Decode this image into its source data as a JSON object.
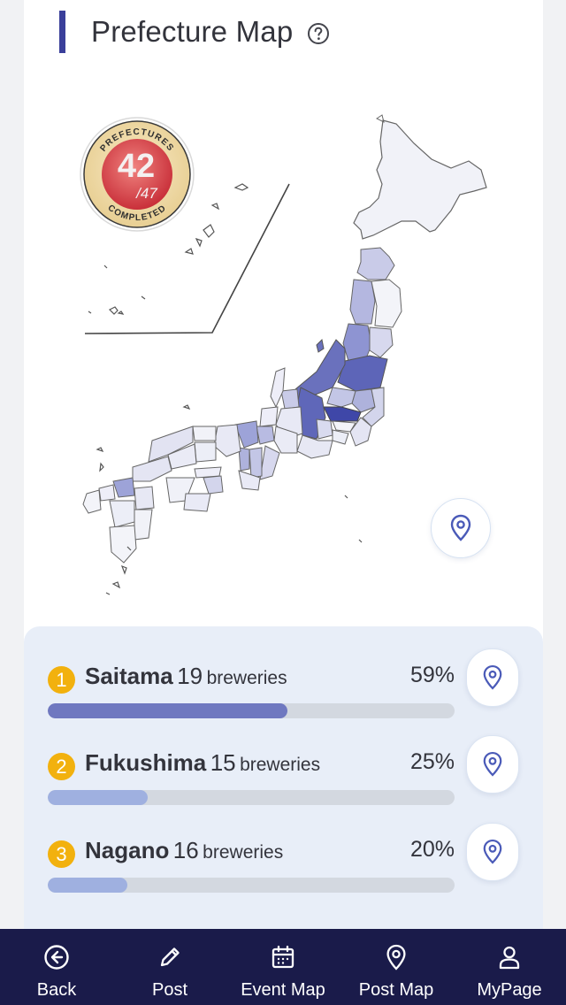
{
  "header": {
    "title": "Prefecture Map"
  },
  "badge": {
    "top_text": "PREFECTURES",
    "bottom_text": "COMPLETED",
    "count": "42",
    "total": "/47"
  },
  "ranking": [
    {
      "rank": "1",
      "name": "Saitama",
      "count": "19",
      "unit": "breweries",
      "percent_label": "59%",
      "progress": 0.59,
      "bar_color": "#6f78c0"
    },
    {
      "rank": "2",
      "name": "Fukushima",
      "count": "15",
      "unit": "breweries",
      "percent_label": "25%",
      "progress": 0.245,
      "bar_color": "#9fb0e0"
    },
    {
      "rank": "3",
      "name": "Nagano",
      "count": "16",
      "unit": "breweries",
      "percent_label": "20%",
      "progress": 0.195,
      "bar_color": "#9fb0e0"
    }
  ],
  "nav": {
    "back": "Back",
    "post": "Post",
    "event_map": "Event Map",
    "post_map": "Post Map",
    "mypage": "MyPage"
  },
  "colors": {
    "accent": "#3a3f9a",
    "nav_bg": "#1a1b4a",
    "rank_badge": "#f2b10e",
    "pin": "#4a5ab8"
  }
}
